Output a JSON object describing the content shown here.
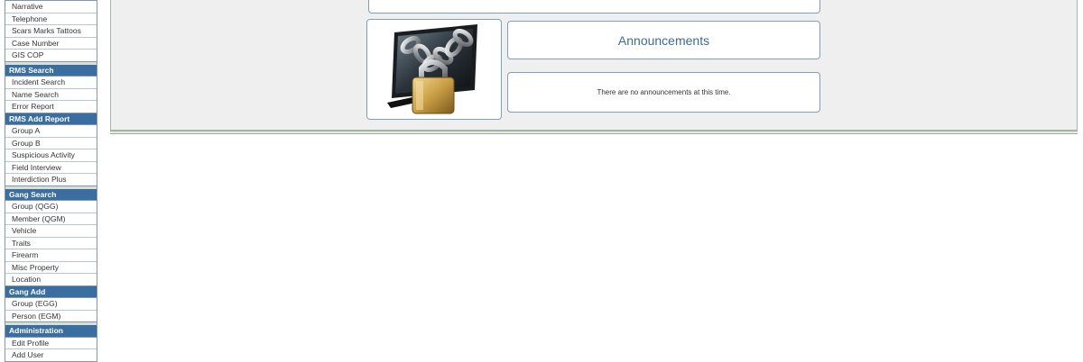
{
  "sidebar": {
    "groups": [
      {
        "header": null,
        "items": [
          "Narrative",
          "Telephone",
          "Scars Marks Tattoos",
          "Case Number",
          "GIS COP"
        ]
      },
      {
        "header": "RMS Search",
        "items": [
          "Incident Search",
          "Name Search",
          "Error Report"
        ]
      },
      {
        "header": "RMS Add Report",
        "items": [
          "Group A",
          "Group B",
          "Suspicious Activity",
          "Field Interview",
          "Interdiction Plus"
        ]
      },
      {
        "header": "Gang Search",
        "items": [
          "Group (QGG)",
          "Member (QGM)",
          "Vehicle",
          "Traits",
          "Firearm",
          "Misc Property",
          "Location"
        ]
      },
      {
        "header": "Gang Add",
        "items": [
          "Group (EGG)",
          "Person (EGM)"
        ]
      },
      {
        "header": "Administration",
        "items": [
          "Edit Profile",
          "Add User"
        ]
      }
    ]
  },
  "announcements": {
    "title": "Announcements",
    "body": "There are no announcements at this time."
  },
  "image": {
    "icon": "monitor-chain-padlock-icon"
  },
  "colors": {
    "sidebar_header_bg": "#3a6ea0",
    "announcement_title": "#3d6a9e",
    "panel_bg": "#efefef"
  }
}
